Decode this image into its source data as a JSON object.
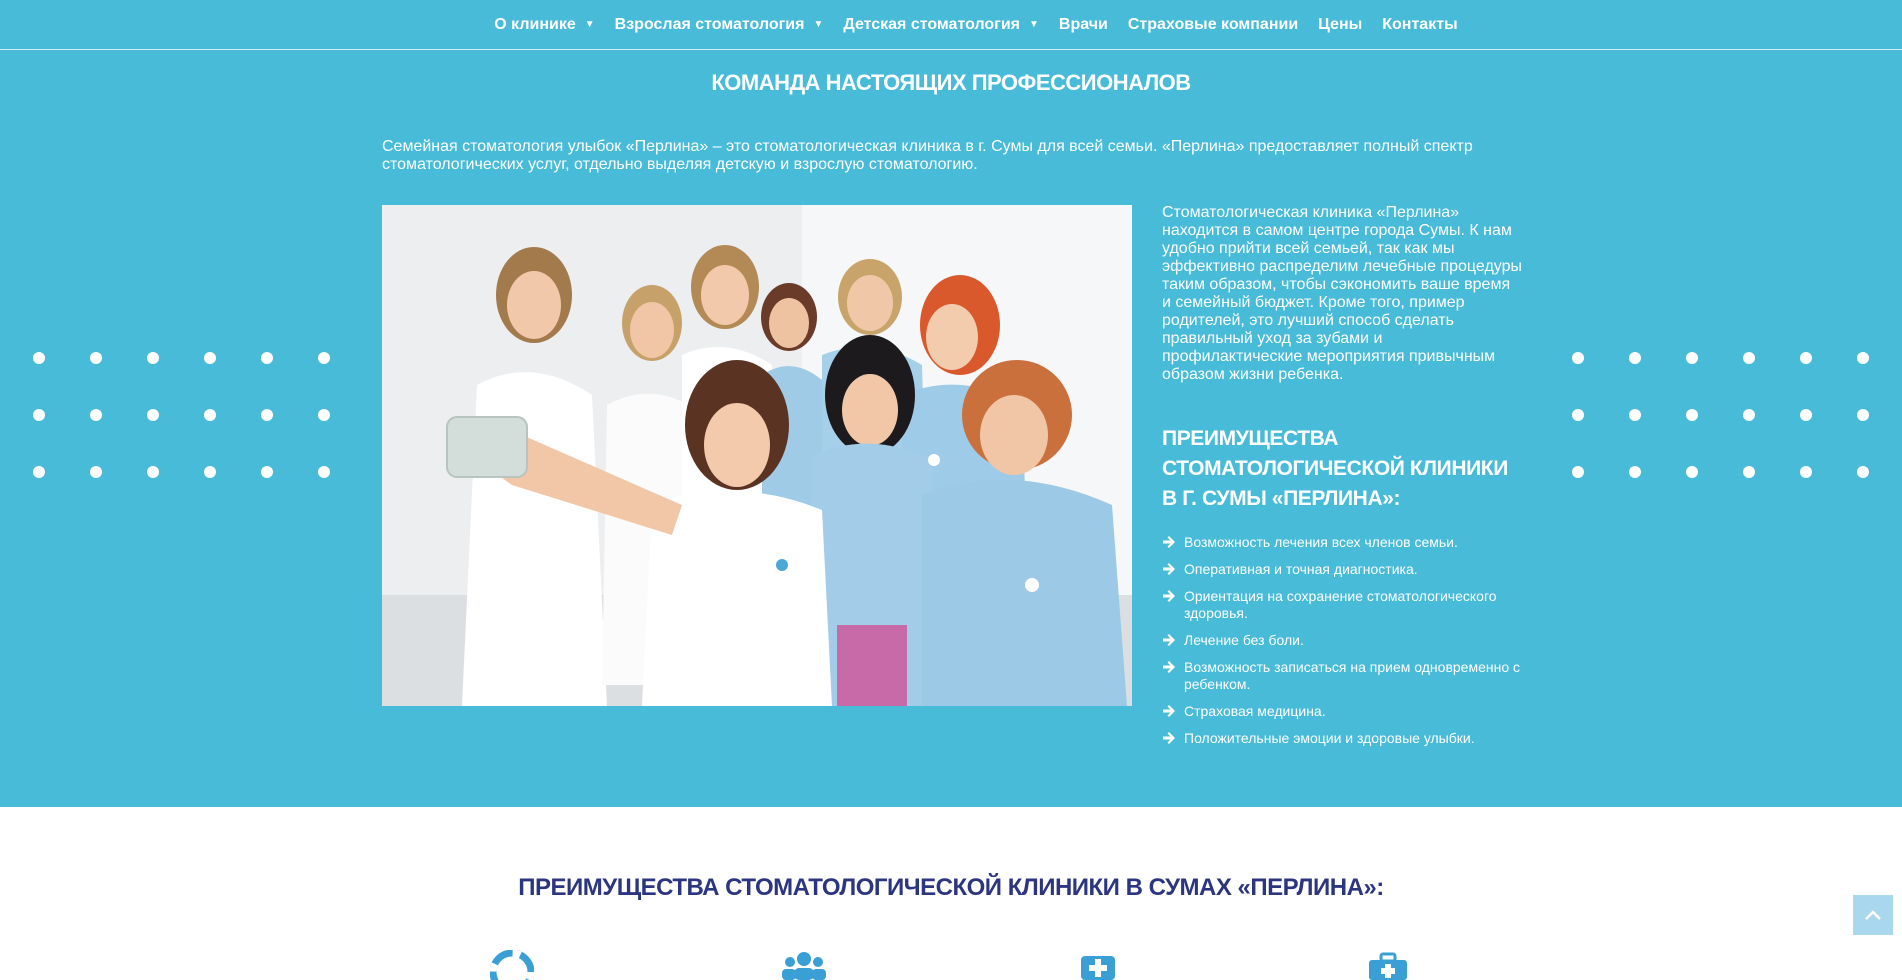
{
  "nav": {
    "items": [
      {
        "label": "О клинике",
        "has_dropdown": true
      },
      {
        "label": "Взрослая стоматология",
        "has_dropdown": true
      },
      {
        "label": "Детская стоматология",
        "has_dropdown": true
      },
      {
        "label": "Врачи",
        "has_dropdown": false
      },
      {
        "label": "Страховые компании",
        "has_dropdown": false
      },
      {
        "label": "Цены",
        "has_dropdown": false
      },
      {
        "label": "Контакты",
        "has_dropdown": false
      }
    ]
  },
  "hero": {
    "title": "КОМАНДА НАСТОЯЩИХ ПРОФЕССИОНАЛОВ",
    "intro": "Семейная стоматология улыбок «Перлина» – это стоматологическая клиника в г. Сумы для всей семьи. «Перлина» предоставляет полный спектр стоматологических услуг, отдельно выделяя детскую и взрослую стоматологию.",
    "description": "Стоматологическая клиника «Перлина» находится в самом центре города Сумы. К нам удобно прийти всей семьей, так как мы эффективно распределим лечебные процедуры таким образом, чтобы сэкономить ваше время и семейный бюджет. Кроме того, пример родителей, это лучший способ сделать правильный уход за зубами и профилактические мероприятия привычным образом жизни ребенка.",
    "advantages_heading": "ПРЕИМУЩЕСТВА СТОМАТОЛОГИЧЕСКОЙ КЛИНИКИ В Г. СУМЫ «ПЕРЛИНА»:",
    "benefits": [
      "Возможность лечения всех членов семьи.",
      "Оперативная и точная диагностика.",
      "Ориентация на сохранение стоматологического здоровья.",
      "Лечение без боли.",
      "Возможность записаться на прием одновременно с ребенком.",
      "Страховая медицина.",
      "Положительные эмоции и здоровые улыбки."
    ]
  },
  "section2": {
    "title": "ПРЕИМУЩЕСТВА СТОМАТОЛОГИЧЕСКОЙ КЛИНИКИ В СУМАХ «ПЕРЛИНА»:",
    "icons": [
      "lifebuoy-icon",
      "group-icon",
      "medical-cross-icon",
      "medkit-icon"
    ]
  },
  "colors": {
    "hero_bg": "#48bbd9",
    "section2_title": "#2c3580",
    "icon_blue": "#3a9fd5"
  }
}
